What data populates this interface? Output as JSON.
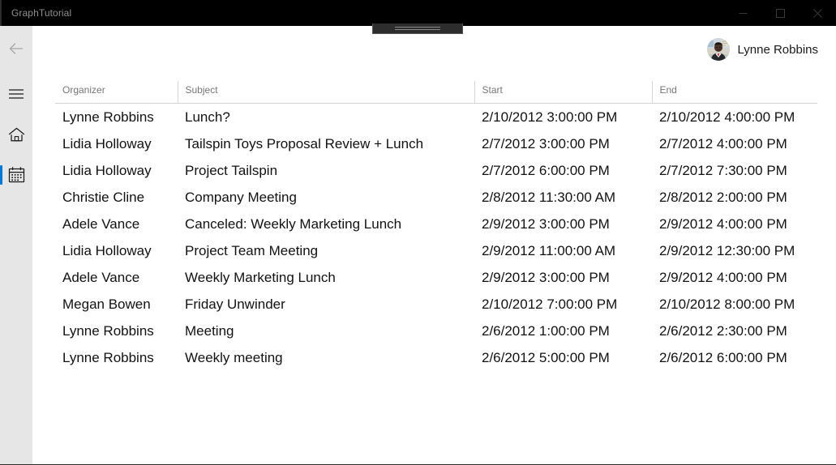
{
  "window": {
    "title": "GraphTutorial",
    "controls": [
      {
        "name": "minimize",
        "label": "Minimize"
      },
      {
        "name": "maximize",
        "label": "Maximize"
      },
      {
        "name": "close",
        "label": "Close"
      }
    ]
  },
  "sidebar": {
    "items": [
      {
        "name": "back",
        "label": "Back",
        "icon": "back-arrow-icon",
        "selected": false,
        "disabled": true
      },
      {
        "name": "menu",
        "label": "Menu",
        "icon": "hamburger-menu-icon",
        "selected": false
      },
      {
        "name": "home",
        "label": "Home",
        "icon": "home-icon",
        "selected": false
      },
      {
        "name": "calendar",
        "label": "Calendar",
        "icon": "calendar-icon",
        "selected": true
      }
    ],
    "accent_color": "#0078d4",
    "background_color": "#e6e6e6"
  },
  "user": {
    "name": "Lynne Robbins",
    "avatar_icon": "user-avatar-photo"
  },
  "table": {
    "columns": [
      {
        "key": "organizer",
        "label": "Organizer"
      },
      {
        "key": "subject",
        "label": "Subject"
      },
      {
        "key": "start",
        "label": "Start"
      },
      {
        "key": "end",
        "label": "End"
      }
    ],
    "rows": [
      {
        "organizer": "Lynne Robbins",
        "subject": "Lunch?",
        "start": "2/10/2012 3:00:00 PM",
        "end": "2/10/2012 4:00:00 PM"
      },
      {
        "organizer": "Lidia Holloway",
        "subject": "Tailspin Toys Proposal Review + Lunch",
        "start": "2/7/2012 3:00:00 PM",
        "end": "2/7/2012 4:00:00 PM"
      },
      {
        "organizer": "Lidia Holloway",
        "subject": "Project Tailspin",
        "start": "2/7/2012 6:00:00 PM",
        "end": "2/7/2012 7:30:00 PM"
      },
      {
        "organizer": "Christie Cline",
        "subject": "Company Meeting",
        "start": "2/8/2012 11:30:00 AM",
        "end": "2/8/2012 2:00:00 PM"
      },
      {
        "organizer": "Adele Vance",
        "subject": "Canceled: Weekly Marketing Lunch",
        "start": "2/9/2012 3:00:00 PM",
        "end": "2/9/2012 4:00:00 PM"
      },
      {
        "organizer": "Lidia Holloway",
        "subject": "Project Team Meeting",
        "start": "2/9/2012 11:00:00 AM",
        "end": "2/9/2012 12:30:00 PM"
      },
      {
        "organizer": "Adele Vance",
        "subject": "Weekly Marketing Lunch",
        "start": "2/9/2012 3:00:00 PM",
        "end": "2/9/2012 4:00:00 PM"
      },
      {
        "organizer": "Megan Bowen",
        "subject": "Friday Unwinder",
        "start": "2/10/2012 7:00:00 PM",
        "end": "2/10/2012 8:00:00 PM"
      },
      {
        "organizer": "Lynne Robbins",
        "subject": "Meeting",
        "start": "2/6/2012 1:00:00 PM",
        "end": "2/6/2012 2:30:00 PM"
      },
      {
        "organizer": "Lynne Robbins",
        "subject": "Weekly meeting",
        "start": "2/6/2012 5:00:00 PM",
        "end": "2/6/2012 6:00:00 PM"
      }
    ]
  }
}
